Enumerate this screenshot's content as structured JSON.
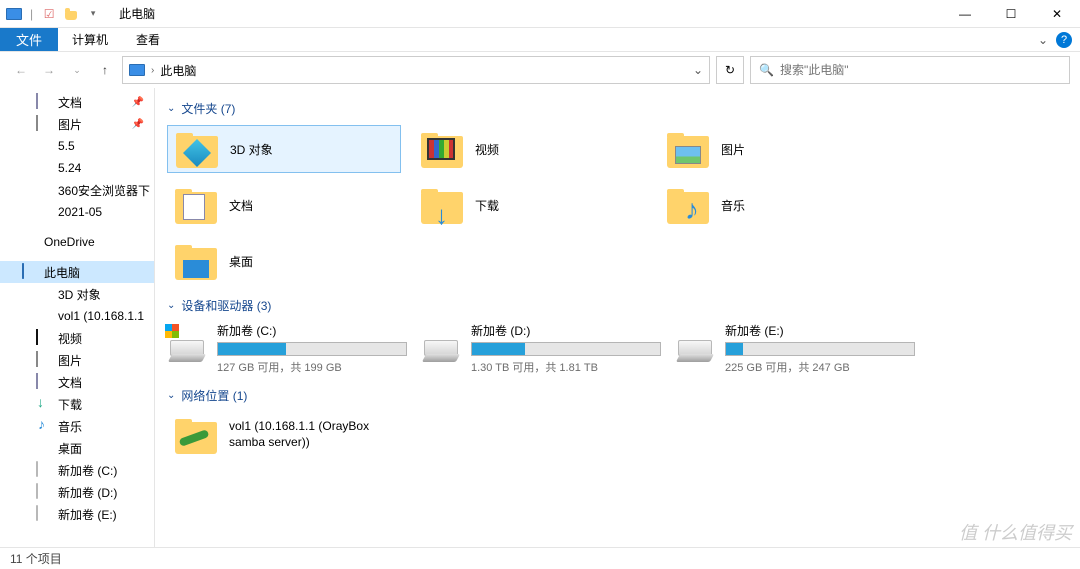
{
  "titlebar": {
    "title": "此电脑",
    "separator": "|"
  },
  "window_controls": {
    "min": "—",
    "max": "☐",
    "close": "✕"
  },
  "ribbon": {
    "file": "文件",
    "tabs": [
      "计算机",
      "查看"
    ],
    "expand": "⌄"
  },
  "nav": {
    "back": "←",
    "forward": "→",
    "recent_dd": "⌄",
    "up": "↑",
    "breadcrumb_root": "此电脑",
    "address_dd": "⌄",
    "refresh": "↻",
    "search_placeholder": "搜索\"此电脑\""
  },
  "sidebar": [
    {
      "label": "文档",
      "icon": "doc",
      "pin": true,
      "depth": 2
    },
    {
      "label": "图片",
      "icon": "pic",
      "pin": true,
      "depth": 2
    },
    {
      "label": "5.5",
      "icon": "folder",
      "depth": 2
    },
    {
      "label": "5.24",
      "icon": "folder",
      "depth": 2
    },
    {
      "label": "360安全浏览器下",
      "icon": "folder",
      "depth": 2
    },
    {
      "label": "2021-05",
      "icon": "folder",
      "depth": 2
    },
    {
      "label": "OneDrive",
      "icon": "onedrive",
      "depth": 1,
      "spacer_before": true
    },
    {
      "label": "此电脑",
      "icon": "pc",
      "depth": 1,
      "selected": true,
      "spacer_before": true
    },
    {
      "label": "3D 对象",
      "icon": "3d",
      "depth": 2
    },
    {
      "label": "vol1 (10.168.1.1",
      "icon": "folder",
      "depth": 2
    },
    {
      "label": "视频",
      "icon": "video",
      "depth": 2
    },
    {
      "label": "图片",
      "icon": "pic",
      "depth": 2
    },
    {
      "label": "文档",
      "icon": "doc",
      "depth": 2
    },
    {
      "label": "下载",
      "icon": "dl",
      "depth": 2
    },
    {
      "label": "音乐",
      "icon": "music",
      "depth": 2
    },
    {
      "label": "桌面",
      "icon": "desk",
      "depth": 2
    },
    {
      "label": "新加卷 (C:)",
      "icon": "disk",
      "depth": 2
    },
    {
      "label": "新加卷 (D:)",
      "icon": "disk",
      "depth": 2
    },
    {
      "label": "新加卷 (E:)",
      "icon": "disk",
      "depth": 2
    }
  ],
  "groups": {
    "folders": {
      "header": "文件夹 (7)",
      "chev": "⌄"
    },
    "drives": {
      "header": "设备和驱动器 (3)",
      "chev": "⌄"
    },
    "network": {
      "header": "网络位置 (1)",
      "chev": "⌄"
    }
  },
  "folders": [
    {
      "label": "3D 对象",
      "overlay": "3d",
      "selected": true
    },
    {
      "label": "视频",
      "overlay": "video"
    },
    {
      "label": "图片",
      "overlay": "pic"
    },
    {
      "label": "文档",
      "overlay": "doc"
    },
    {
      "label": "下载",
      "overlay": "dl"
    },
    {
      "label": "音乐",
      "overlay": "music"
    },
    {
      "label": "桌面",
      "overlay": "desk"
    }
  ],
  "drives": [
    {
      "name": "新加卷 (C:)",
      "info": "127 GB 可用，共 199 GB",
      "fill_pct": 36,
      "os": true
    },
    {
      "name": "新加卷 (D:)",
      "info": "1.30 TB 可用，共 1.81 TB",
      "fill_pct": 28
    },
    {
      "name": "新加卷 (E:)",
      "info": "225 GB 可用，共 247 GB",
      "fill_pct": 9
    }
  ],
  "network": [
    {
      "label": "vol1 (10.168.1.1 (OrayBox samba server))"
    }
  ],
  "status": {
    "items": "11 个项目"
  },
  "watermark": "值 什么值得买"
}
